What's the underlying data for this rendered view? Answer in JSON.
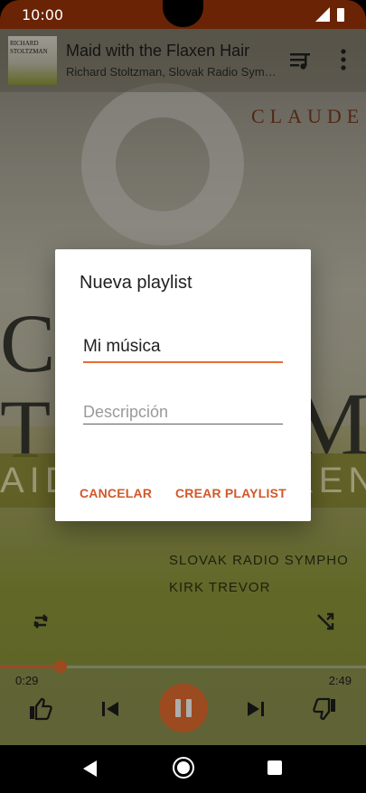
{
  "status_bar": {
    "time": "10:00"
  },
  "now_playing": {
    "title": "Maid with the Flaxen Hair",
    "artist": "Richard Stoltzman, Slovak Radio Sym…",
    "thumb_text": "RICHARD\nSTOLTZMAN"
  },
  "album_art_text": {
    "claude": "CLAUDE",
    "st": "CH",
    "to": "TO",
    "m": "M",
    "aid": "AID",
    "ken": "KEN",
    "slovak": "SLOVAK RADIO SYMPHO",
    "kirk": "KIRK TREVOR"
  },
  "playback": {
    "current_time": "0:29",
    "total_time": "2:49",
    "progress": 0.165
  },
  "dialog": {
    "title": "Nueva playlist",
    "name_value": "Mi música",
    "description_placeholder": "Descripción",
    "cancel_label": "CANCELAR",
    "create_label": "CREAR PLAYLIST"
  },
  "colors": {
    "accent": "#e66d2e",
    "status_bar": "#6b2305",
    "button_text": "#d1582a"
  },
  "icons": [
    "queue-icon",
    "more-icon",
    "repeat-icon",
    "shuffle-icon",
    "thumb-up-icon",
    "previous-icon",
    "pause-icon",
    "next-icon",
    "thumb-down-icon",
    "back-icon",
    "home-icon",
    "recents-icon",
    "signal-icon",
    "battery-icon"
  ]
}
